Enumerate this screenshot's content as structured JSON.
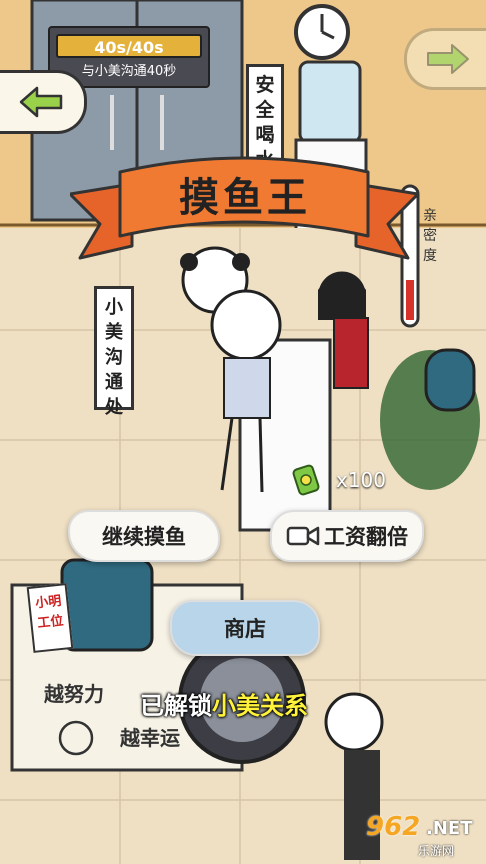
{
  "hud": {
    "timer_value": "40s/40s",
    "timer_desc": "与小美沟通40秒"
  },
  "title": "摸鱼王",
  "signs": {
    "water": [
      "安",
      "全",
      "喝",
      "水"
    ],
    "comm": [
      "小",
      "美",
      "沟",
      "通",
      "处"
    ],
    "intimacy": [
      "亲",
      "密",
      "度"
    ],
    "desk": [
      "小明",
      "工位"
    ]
  },
  "desk_text": {
    "line1": "越努力",
    "line2": "越幸运"
  },
  "reward": {
    "icon": "money-icon",
    "count": "x100"
  },
  "buttons": {
    "continue": "继续摸鱼",
    "double": "工资翻倍",
    "double_icon": "video-icon",
    "shop": "商店"
  },
  "unlock": {
    "prefix": "已解锁",
    "highlight": "小美关系"
  },
  "watermark": {
    "number": "962",
    "suffix": ".NET",
    "sub": "乐游网"
  },
  "colors": {
    "ribbon": "#f07a32",
    "highlight": "#fff23a",
    "timer_bar": "#e4b23b"
  }
}
